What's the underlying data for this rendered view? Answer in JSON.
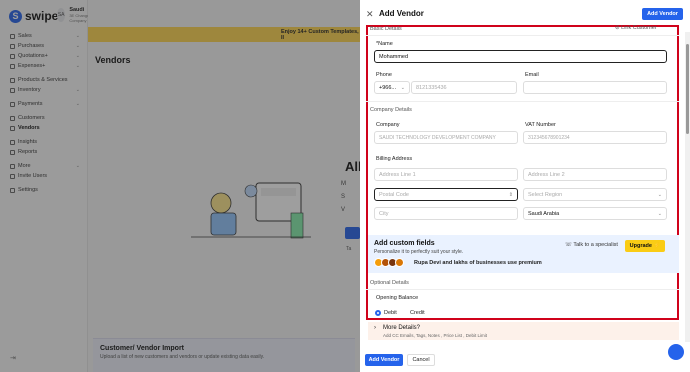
{
  "app": {
    "logo_text": "swipe",
    "org_initials": "SA",
    "org_name": "Saudi",
    "org_sub": "3E Change Company"
  },
  "sidebar": {
    "items": [
      {
        "label": "Sales",
        "icon": "sales-icon",
        "chevron": "⌄"
      },
      {
        "label": "Purchases",
        "icon": "purchases-icon",
        "chevron": "⌄"
      },
      {
        "label": "Quotations+",
        "icon": "quotations-icon",
        "chevron": "⌄"
      },
      {
        "label": "Expenses+",
        "icon": "expenses-icon",
        "chevron": "⌄"
      },
      {
        "label": "Products & Services",
        "icon": "products-icon",
        "chevron": ""
      },
      {
        "label": "Inventory",
        "icon": "inventory-icon",
        "chevron": "⌄"
      },
      {
        "label": "Payments",
        "icon": "payments-icon",
        "chevron": "⌄"
      },
      {
        "label": "Customers",
        "icon": "customers-icon",
        "chevron": ""
      },
      {
        "label": "Vendors",
        "icon": "vendors-icon",
        "chevron": ""
      },
      {
        "label": "Insights",
        "icon": "insights-icon",
        "chevron": ""
      },
      {
        "label": "Reports",
        "icon": "reports-icon",
        "chevron": ""
      },
      {
        "label": "More",
        "icon": "more-icon",
        "chevron": "⌄"
      },
      {
        "label": "Invite Users",
        "icon": "invite-icon",
        "chevron": ""
      },
      {
        "label": "Settings",
        "icon": "settings-icon",
        "chevron": ""
      }
    ],
    "collapse": "⇥"
  },
  "main": {
    "banner": "Enjoy 14+ Custom Templates, Il",
    "title": "Vendors",
    "all_text": "All",
    "bullets": [
      "M",
      "S",
      "V"
    ],
    "import_title": "Customer/ Vendor Import",
    "import_sub": "Upload a list of new customers and vendors or update existing data easily.",
    "ta": "Ta"
  },
  "drawer": {
    "title": "Add Vendor",
    "head_button": "Add Vendor",
    "basic_details": "Basic Details",
    "link_customer": "Link Customer",
    "name_label": "*Name",
    "name_value": "Mohammed",
    "phone_label": "Phone",
    "phone_code": "+966...",
    "phone_placeholder": "8121335436",
    "email_label": "Email",
    "company_details": "Company Details",
    "company_label": "Company",
    "company_value": "SAUDI TECHNOLOGY DEVELOPMENT COMPANY",
    "vat_label": "VAT Number",
    "vat_value": "312345678901234",
    "billing_label": "Billing Address",
    "addr1": "Address Line 1",
    "addr2": "Address Line 2",
    "postal": "Postal Code",
    "region": "Select Region",
    "city": "City",
    "country": "Saudi Arabia",
    "custom_title": "Add custom fields",
    "custom_sub": "Personalize it to perfectly suit your style.",
    "custom_note": "Rupa Devi and lakhs of businesses use premium",
    "talk": "Talk to a specialist",
    "upgrade": "Upgrade ⚡",
    "optional": "Optional Details",
    "opening_balance": "Opening Balance",
    "debit": "Debit",
    "credit": "Credit",
    "more_title": "More Details?",
    "more_sub": "Add CC Emails, Tags, Notes , Price List , Debit Limit",
    "footer_add": "Add Vendor",
    "footer_cancel": "Cancel"
  }
}
